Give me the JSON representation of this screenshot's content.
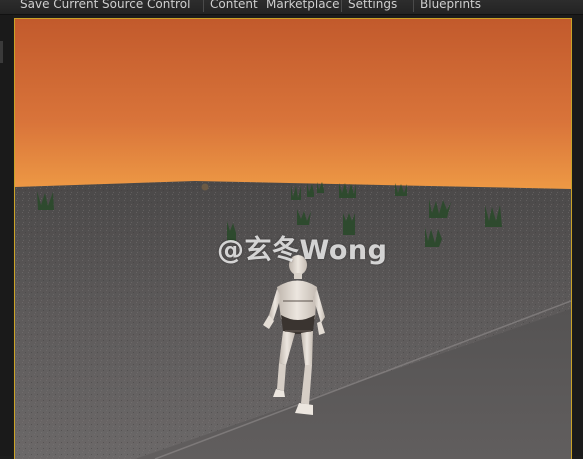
{
  "toolbar": {
    "buttons": [
      {
        "label": "Save Current"
      },
      {
        "label": "Source Control"
      },
      {
        "label": "Content"
      },
      {
        "label": "Marketplace"
      },
      {
        "label": "Settings"
      },
      {
        "label": "Blueprints"
      }
    ]
  },
  "viewport": {
    "accent_color": "#c9a227",
    "sky_color_top": "#c7592a",
    "sky_color_horizon": "#e9893f",
    "ground_color": "#5c5a5a"
  },
  "watermark": {
    "text": "@玄冬Wong"
  }
}
